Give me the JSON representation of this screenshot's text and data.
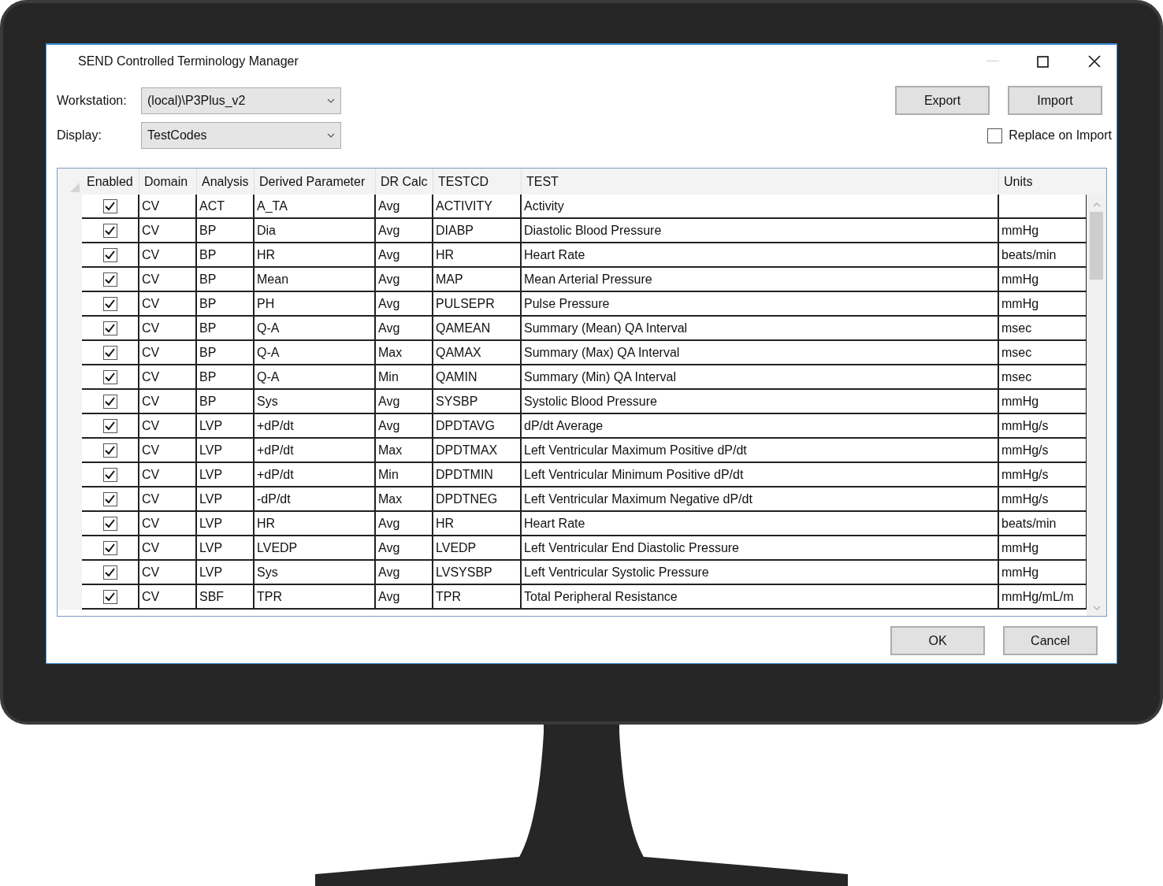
{
  "window": {
    "title": "SEND Controlled Terminology Manager"
  },
  "workstation": {
    "label": "Workstation:",
    "value": "(local)\\P3Plus_v2"
  },
  "display": {
    "label": "Display:",
    "value": "TestCodes"
  },
  "buttons": [
    "Export",
    "Import"
  ],
  "replace_on_import": {
    "label": "Replace on Import",
    "checked": false
  },
  "table": {
    "columns": [
      "Enabled",
      "Domain",
      "Analysis",
      "Derived Parameter",
      "DR Calc",
      "TESTCD",
      "TEST",
      "Units"
    ],
    "rows": [
      {
        "enabled": true,
        "domain": "CV",
        "analysis": "ACT",
        "derived_parameter": "A_TA",
        "dr_calc": "Avg",
        "testcd": "ACTIVITY",
        "test": "Activity"
      },
      {
        "enabled": true,
        "domain": "CV",
        "analysis": "BP",
        "derived_parameter": "Dia",
        "dr_calc": "Avg",
        "testcd": "DIABP",
        "test": "Diastolic Blood Pressure",
        "units": "mmHg"
      },
      {
        "enabled": true,
        "domain": "CV",
        "analysis": "BP",
        "derived_parameter": "HR",
        "dr_calc": "Avg",
        "testcd": "HR",
        "test": "Heart Rate",
        "units": "beats/min"
      },
      {
        "enabled": true,
        "domain": "CV",
        "analysis": "BP",
        "derived_parameter": "Mean",
        "dr_calc": "Avg",
        "testcd": "MAP",
        "test": "Mean Arterial Pressure",
        "units": "mmHg"
      },
      {
        "enabled": true,
        "domain": "CV",
        "analysis": "BP",
        "derived_parameter": "PH",
        "dr_calc": "Avg",
        "testcd": "PULSEPR",
        "test": "Pulse Pressure",
        "units": "mmHg"
      },
      {
        "enabled": true,
        "domain": "CV",
        "analysis": "BP",
        "derived_parameter": "Q-A",
        "dr_calc": "Avg",
        "testcd": "QAMEAN",
        "test": "Summary (Mean) QA Interval",
        "units": "msec"
      },
      {
        "enabled": true,
        "domain": "CV",
        "analysis": "BP",
        "derived_parameter": "Q-A",
        "dr_calc": "Max",
        "testcd": "QAMAX",
        "test": "Summary (Max) QA Interval",
        "units": "msec"
      },
      {
        "enabled": true,
        "domain": "CV",
        "analysis": "BP",
        "derived_parameter": "Q-A",
        "dr_calc": "Min",
        "testcd": "QAMIN",
        "test": "Summary (Min) QA Interval",
        "units": "msec"
      },
      {
        "enabled": true,
        "domain": "CV",
        "analysis": "BP",
        "derived_parameter": "Sys",
        "dr_calc": "Avg",
        "testcd": "SYSBP",
        "test": "Systolic Blood Pressure",
        "units": "mmHg"
      },
      {
        "enabled": true,
        "domain": "CV",
        "analysis": "LVP",
        "derived_parameter": "+dP/dt",
        "dr_calc": "Avg",
        "testcd": "DPDTAVG",
        "test": "dP/dt Average",
        "units": "mmHg/s"
      },
      {
        "enabled": true,
        "domain": "CV",
        "analysis": "LVP",
        "derived_parameter": "+dP/dt",
        "dr_calc": "Max",
        "testcd": "DPDTMAX",
        "test": "Left Ventricular Maximum Positive dP/dt",
        "units": "mmHg/s"
      },
      {
        "enabled": true,
        "domain": "CV",
        "analysis": "LVP",
        "derived_parameter": "+dP/dt",
        "dr_calc": "Min",
        "testcd": "DPDTMIN",
        "test": "Left Ventricular Minimum Positive dP/dt",
        "units": "mmHg/s"
      },
      {
        "enabled": true,
        "domain": "CV",
        "analysis": "LVP",
        "derived_parameter": "-dP/dt",
        "dr_calc": "Max",
        "testcd": "DPDTNEG",
        "test": "Left Ventricular Maximum Negative dP/dt",
        "units": "mmHg/s"
      },
      {
        "enabled": true,
        "domain": "CV",
        "analysis": "LVP",
        "derived_parameter": "HR",
        "dr_calc": "Avg",
        "testcd": "HR",
        "test": "Heart Rate",
        "units": "beats/min"
      },
      {
        "enabled": true,
        "domain": "CV",
        "analysis": "LVP",
        "derived_parameter": "LVEDP",
        "dr_calc": "Avg",
        "testcd": "LVEDP",
        "test": "Left Ventricular End Diastolic Pressure",
        "units": "mmHg"
      },
      {
        "enabled": true,
        "domain": "CV",
        "analysis": "LVP",
        "derived_parameter": "Sys",
        "dr_calc": "Avg",
        "testcd": "LVSYSBP",
        "test": "Left Ventricular Systolic Pressure",
        "units": "mmHg"
      },
      {
        "enabled": true,
        "domain": "CV",
        "analysis": "SBF",
        "derived_parameter": "TPR",
        "dr_calc": "Avg",
        "testcd": "TPR",
        "test": "Total Peripheral Resistance",
        "units": "mmHg/mL/m"
      }
    ]
  },
  "footer_buttons": [
    "OK",
    "Cancel"
  ]
}
